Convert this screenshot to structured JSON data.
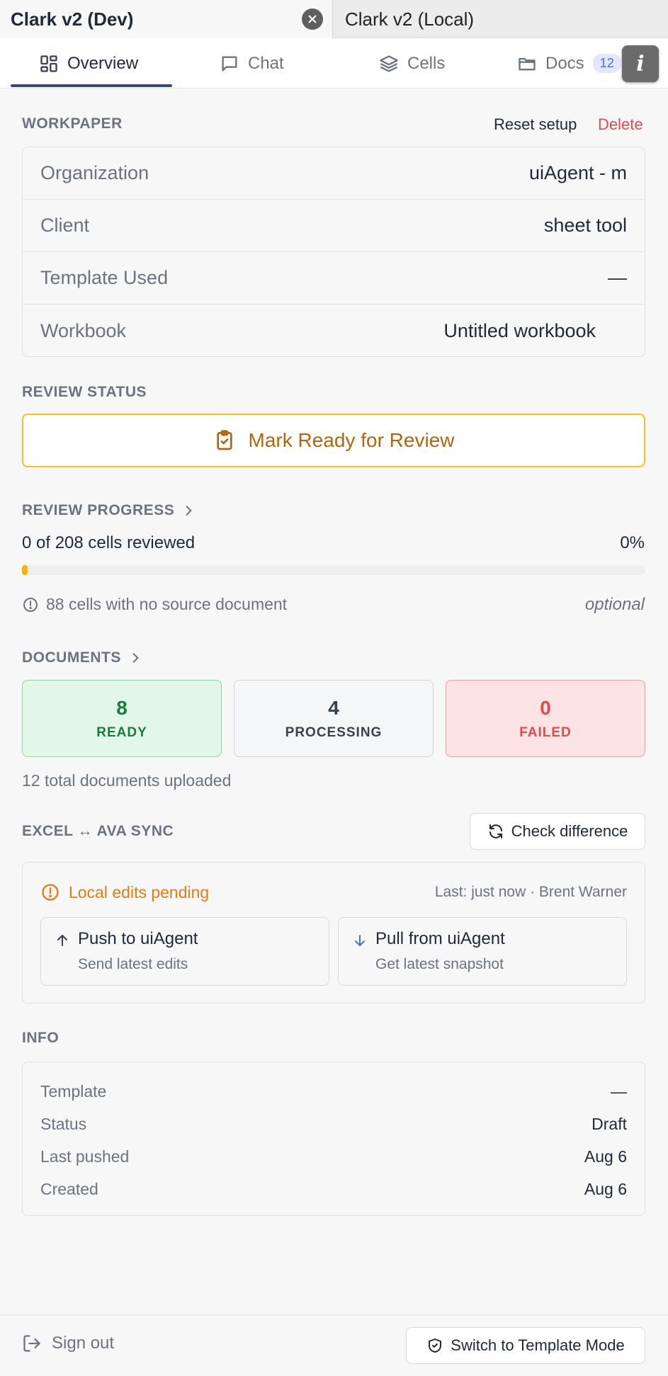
{
  "window_tabs": [
    {
      "label": "Clark v2 (Dev)",
      "active": true
    },
    {
      "label": "Clark v2 (Local)",
      "active": false
    }
  ],
  "nav": {
    "tabs": [
      {
        "label": "Overview",
        "icon": "grid-icon"
      },
      {
        "label": "Chat",
        "icon": "chat-icon"
      },
      {
        "label": "Cells",
        "icon": "layers-icon"
      },
      {
        "label": "Docs",
        "icon": "folder-icon"
      }
    ],
    "docs_badge": "12",
    "info_label": "i"
  },
  "workpaper": {
    "title": "WORKPAPER",
    "reset_label": "Reset setup",
    "delete_label": "Delete",
    "rows": [
      {
        "key": "Organization",
        "value": "uiAgent - m"
      },
      {
        "key": "Client",
        "value": "sheet tool"
      },
      {
        "key": "Template Used",
        "value": "—"
      },
      {
        "key": "Workbook",
        "value": "Untitled workbook"
      }
    ]
  },
  "review_status": {
    "title": "REVIEW STATUS",
    "button_label": "Mark Ready for Review"
  },
  "review_progress": {
    "title": "REVIEW PROGRESS",
    "summary": "0 of 208 cells reviewed",
    "percent_label": "0%",
    "percent": 0,
    "no_source": "88 cells with no source document",
    "optional_label": "optional"
  },
  "documents": {
    "title": "DOCUMENTS",
    "ready": {
      "count": "8",
      "label": "READY"
    },
    "processing": {
      "count": "4",
      "label": "PROCESSING"
    },
    "failed": {
      "count": "0",
      "label": "FAILED"
    },
    "total": "12 total documents uploaded"
  },
  "sync": {
    "title": "EXCEL ↔ AVA SYNC",
    "check_label": "Check difference",
    "pending_label": "Local edits pending",
    "last_meta": "Last: just now · Brent Warner",
    "push": {
      "title": "Push to uiAgent",
      "sub": "Send latest edits"
    },
    "pull": {
      "title": "Pull from uiAgent",
      "sub": "Get latest snapshot"
    }
  },
  "info": {
    "title": "INFO",
    "rows": [
      {
        "key": "Template",
        "value": "—"
      },
      {
        "key": "Status",
        "value": "Draft"
      },
      {
        "key": "Last pushed",
        "value": "Aug 6"
      },
      {
        "key": "Created",
        "value": "Aug 6"
      }
    ]
  },
  "footer": {
    "signout_label": "Sign out",
    "template_mode_label": "Switch to Template Mode"
  },
  "colors": {
    "accent_nav": "#3b4a73",
    "review_border": "#f0c419",
    "review_text": "#b4650b",
    "delete": "#e5484d",
    "pending": "#e07c14",
    "ready": "#1c7a3f",
    "failed": "#e5484d"
  }
}
